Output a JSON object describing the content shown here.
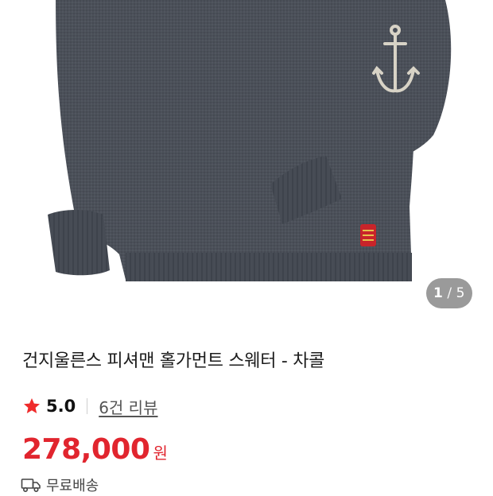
{
  "gallery": {
    "image_alt": "charcoal knit sweater with anchor motif",
    "current": "1",
    "separator": "/",
    "total": "5"
  },
  "product": {
    "title": "건지울른스 피셔맨 홀가먼트 스웨터 - 차콜",
    "star_icon": "star-icon",
    "rating": "5.0",
    "reviews_label": "6건 리뷰",
    "price": "278,000",
    "currency": "원",
    "shipping_icon": "truck-icon",
    "shipping_label": "무료배송"
  },
  "colors": {
    "accent": "#e1252e",
    "sweater": "#4a4f57",
    "counter_bg": "#9a9a9a"
  }
}
